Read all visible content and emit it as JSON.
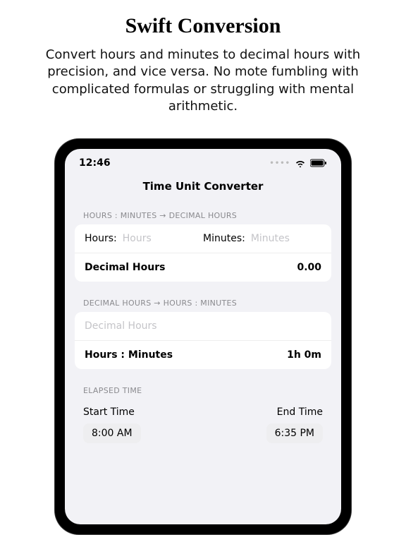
{
  "marketing": {
    "title": "Swift Conversion",
    "subtitle": "Convert hours and minutes to decimal hours with precision, and vice versa. No mote fumbling with complicated formulas or struggling with mental arithmetic."
  },
  "status": {
    "time": "12:46"
  },
  "app": {
    "title": "Time Unit Converter"
  },
  "section1": {
    "header": "HOURS : MINUTES → DECIMAL HOURS",
    "hours_label": "Hours:",
    "hours_placeholder": "Hours",
    "minutes_label": "Minutes:",
    "minutes_placeholder": "Minutes",
    "result_label": "Decimal Hours",
    "result_value": "0.00"
  },
  "section2": {
    "header": "DECIMAL HOURS → HOURS : MINUTES",
    "decimal_placeholder": "Decimal Hours",
    "result_label": "Hours : Minutes",
    "result_value": "1h 0m"
  },
  "section3": {
    "header": "ELAPSED TIME",
    "start_label": "Start Time",
    "start_value": "8:00 AM",
    "end_label": "End Time",
    "end_value": "6:35 PM"
  }
}
